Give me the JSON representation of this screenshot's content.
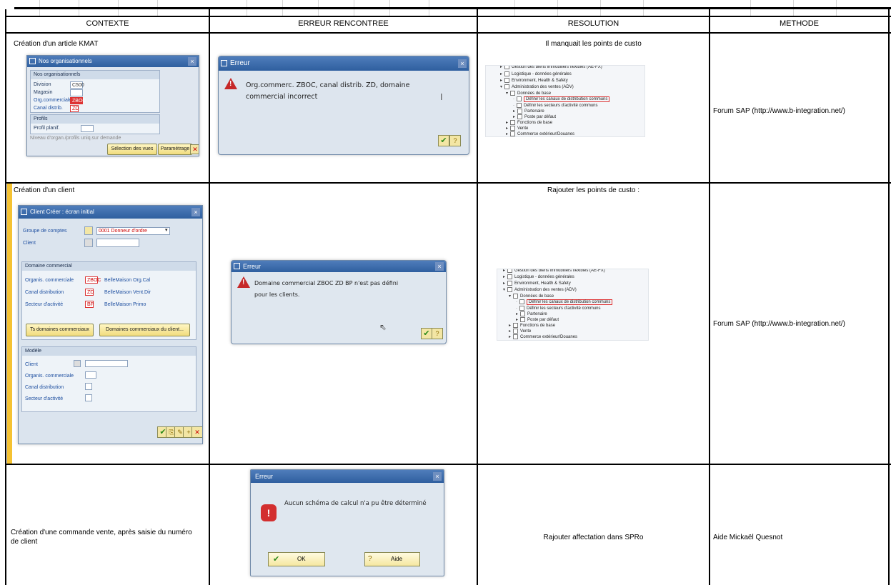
{
  "headers": {
    "contexte": "CONTEXTE",
    "erreur": "ERREUR RENCONTREE",
    "resolution": "RESOLUTION",
    "methode": "METHODE"
  },
  "rows": [
    {
      "contexte": "Création d'un article KMAT",
      "resolution": "Il manquait les points de custo",
      "methode": "Forum SAP (http://www.b-integration.net/)"
    },
    {
      "contexte": "Création d'un client",
      "resolution": "Rajouter les points de custo :",
      "methode": "Forum SAP (http://www.b-integration.net/)"
    },
    {
      "contexte": "Création d'une commande vente, après saisie du numéro de client",
      "resolution": "Rajouter affectation dans SPRo",
      "methode": "Aide Mickaël Quesnot"
    }
  ],
  "shot1": {
    "title": "Nos organisationnels",
    "group1": "Nos organisationnels",
    "labels": [
      "Division",
      "Magasin",
      "Org.commerciale",
      "Canal distrib."
    ],
    "values": [
      "C500",
      "",
      "ZBOC",
      "ZD"
    ],
    "group2": "Profils",
    "profil_label": "Profil planif.",
    "checkbox": "Niveau d'organ./profils uniq.sur demande",
    "btn_views": "Sélection des vues",
    "btn_param": "Paramétrage"
  },
  "shot2": {
    "title": "Client Créer : écran initial",
    "groupe_label": "Groupe de comptes",
    "groupe_value": "0001 Donneur d'ordre",
    "client_label": "Client",
    "domaine_hdr": "Domaine commercial",
    "dom_labels": [
      "Organis. commerciale",
      "Canal distribution",
      "Secteur d'activité"
    ],
    "dom_codes": [
      "ZBOC",
      "ZD",
      "BP"
    ],
    "dom_names": [
      "BelleMaison Org.Cal",
      "BelleMaison Vent.Dir",
      "BelleMaison Primo"
    ],
    "btn_ts": "Ts domaines commerciaux",
    "btn_client": "Domaines commerciaux du client...",
    "modele_hdr": "Modèle",
    "mod_labels": [
      "Client",
      "Organis. commerciale",
      "Canal distribution",
      "Secteur d'activité"
    ]
  },
  "err1": {
    "title": "Erreur",
    "message_l1": "Org.commerc. ZBOC, canal distrib. ZD, domaine",
    "message_l2": "commercial incorrect"
  },
  "err2": {
    "title": "Erreur",
    "message_l1": "Domaine commercial ZBOC ZD BP n'est pas défini",
    "message_l2": "pour les clients."
  },
  "err3": {
    "title": "Erreur",
    "message": "Aucun schéma de calcul n'a pu être déterminé",
    "ok": "OK",
    "aide": "Aide"
  },
  "tree": {
    "items": [
      "Gestion des biens immobiliers flexibles (AE-FX)",
      "Logistique - données générales",
      "Environment, Health & Safety",
      "Administration des ventes (ADV)",
      "Données de base",
      "Définir les canaux de distribution communs",
      "Définir les secteurs d'activité communs",
      "Partenaire",
      "Poste par défaut",
      "Fonctions de base",
      "Vente",
      "Commerce extérieur/Douanes"
    ]
  }
}
